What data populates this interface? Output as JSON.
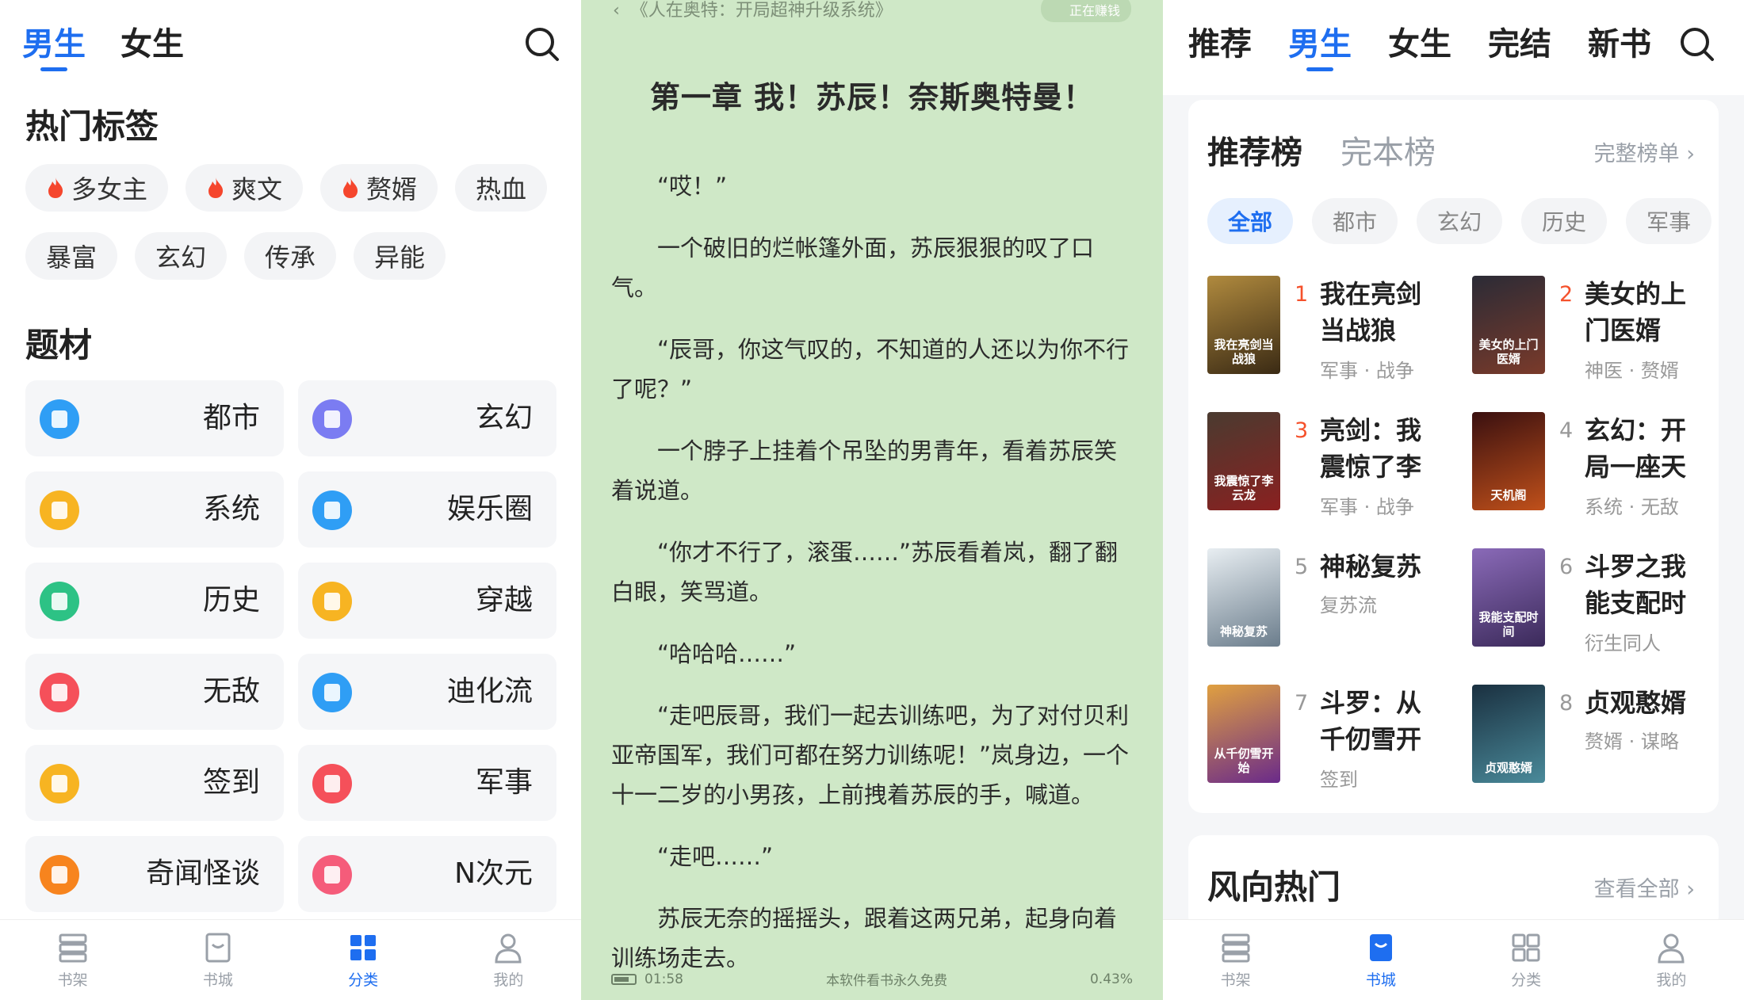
{
  "left": {
    "tabs": [
      {
        "label": "男生",
        "active": true
      },
      {
        "label": "女生",
        "active": false
      }
    ],
    "hot_tags_title": "热门标签",
    "hot_tags_row1": [
      {
        "label": "多女主",
        "hot": true
      },
      {
        "label": "爽文",
        "hot": true
      },
      {
        "label": "赘婿",
        "hot": true
      },
      {
        "label": "热血",
        "hot": false
      }
    ],
    "hot_tags_row2": [
      {
        "label": "暴富"
      },
      {
        "label": "玄幻"
      },
      {
        "label": "传承"
      },
      {
        "label": "异能"
      }
    ],
    "genre_title": "题材",
    "genres": [
      {
        "label": "都市",
        "color": "#2f9ef5",
        "icon": "book-icon"
      },
      {
        "label": "玄幻",
        "color": "#7b7cf2",
        "icon": "swords-icon"
      },
      {
        "label": "系统",
        "color": "#f7b422",
        "icon": "document-icon"
      },
      {
        "label": "娱乐圈",
        "color": "#2f9ef5",
        "icon": "microphone-icon"
      },
      {
        "label": "历史",
        "color": "#2dc285",
        "icon": "building-icon"
      },
      {
        "label": "穿越",
        "color": "#f7b422",
        "icon": "portal-icon"
      },
      {
        "label": "无敌",
        "color": "#f5505a",
        "icon": "fist-icon"
      },
      {
        "label": "迪化流",
        "color": "#2f9ef5",
        "icon": "brain-icon"
      },
      {
        "label": "签到",
        "color": "#f7b422",
        "icon": "location-pin-icon"
      },
      {
        "label": "军事",
        "color": "#f5505a",
        "icon": "rocket-icon"
      },
      {
        "label": "奇闻怪谈",
        "color": "#f7841e",
        "icon": "bulb-icon"
      },
      {
        "label": "N次元",
        "color": "#f55c7a",
        "icon": "fish-icon"
      }
    ],
    "nav": [
      {
        "label": "书架",
        "active": false
      },
      {
        "label": "书城",
        "active": false
      },
      {
        "label": "分类",
        "active": true
      },
      {
        "label": "我的",
        "active": false
      }
    ]
  },
  "reader": {
    "book_title": "《人在奥特：开局超神升级系统》",
    "earn_badge": "正在赚钱",
    "chapter_title": "第一章 我！苏辰！奈斯奥特曼！",
    "paragraphs": [
      "“哎！”",
      "一个破旧的烂帐篷外面，苏辰狠狠的叹了口气。",
      "“辰哥，你这气叹的，不知道的人还以为你不行了呢？”",
      "一个脖子上挂着个吊坠的男青年，看着苏辰笑着说道。",
      "“你才不行了，滚蛋……”苏辰看着岚，翻了翻白眼，笑骂道。",
      "“哈哈哈……”",
      "“走吧辰哥，我们一起去训练吧，为了对付贝利亚帝国军，我们可都在努力训练呢！”岚身边，一个十一二岁的小男孩，上前拽着苏辰的手，喊道。",
      "“走吧……”",
      "苏辰无奈的摇摇头，跟着这两兄弟，起身向着训练场走去。"
    ],
    "time": "01:58",
    "footer_note": "本软件看书永久免费",
    "progress": "0.43%"
  },
  "right": {
    "tabs": [
      {
        "label": "推荐",
        "active": false
      },
      {
        "label": "男生",
        "active": true
      },
      {
        "label": "女生",
        "active": false
      },
      {
        "label": "完结",
        "active": false
      },
      {
        "label": "新书",
        "active": false
      }
    ],
    "rank_tabs": [
      {
        "label": "推荐榜",
        "active": true
      },
      {
        "label": "完本榜",
        "active": false
      }
    ],
    "full_list_link": "完整榜单 ›",
    "chips": [
      {
        "label": "全部",
        "active": true
      },
      {
        "label": "都市",
        "active": false
      },
      {
        "label": "玄幻",
        "active": false
      },
      {
        "label": "历史",
        "active": false
      },
      {
        "label": "军事",
        "active": false
      }
    ],
    "books": [
      {
        "rank": "1",
        "title": "我在亮剑当战狼",
        "tags": "军事 · 战争",
        "cover_text": "我在亮剑当战狼",
        "cover_colors": [
          "#b08a3e",
          "#3a2a14"
        ]
      },
      {
        "rank": "2",
        "title": "美女的上门医婿",
        "tags": "神医 · 赘婿",
        "cover_text": "美女的上门医婿",
        "cover_colors": [
          "#2b2b36",
          "#7a3a2a"
        ]
      },
      {
        "rank": "3",
        "title": "亮剑：我震惊了李",
        "tags": "军事 · 战争",
        "cover_text": "我震惊了李云龙",
        "cover_colors": [
          "#4a3b30",
          "#8a2020"
        ]
      },
      {
        "rank": "4",
        "title": "玄幻：开局一座天",
        "tags": "系统 · 无敌",
        "cover_text": "天机阁",
        "cover_colors": [
          "#3a1010",
          "#c0501a"
        ]
      },
      {
        "rank": "5",
        "title": "神秘复苏",
        "tags": "复苏流",
        "cover_text": "神秘复苏",
        "cover_colors": [
          "#e8eef2",
          "#6b7d8c"
        ]
      },
      {
        "rank": "6",
        "title": "斗罗之我能支配时",
        "tags": "衍生同人",
        "cover_text": "我能支配时间",
        "cover_colors": [
          "#8a6ab8",
          "#3b2a5a"
        ]
      },
      {
        "rank": "7",
        "title": "斗罗：从千仞雪开",
        "tags": "签到",
        "cover_text": "从千仞雪开始",
        "cover_colors": [
          "#e0a040",
          "#6a2a8a"
        ]
      },
      {
        "rank": "8",
        "title": "贞观憨婿",
        "tags": "赘婿 · 谋略",
        "cover_text": "贞观憨婿",
        "cover_colors": [
          "#1a3040",
          "#4a8a9a"
        ]
      }
    ],
    "trend_title": "风向热门",
    "view_all_link": "查看全部 ›",
    "nav": [
      {
        "label": "书架",
        "active": false
      },
      {
        "label": "书城",
        "active": true
      },
      {
        "label": "分类",
        "active": false
      },
      {
        "label": "我的",
        "active": false
      }
    ]
  },
  "colors": {
    "accent": "#1e6ef0",
    "rank_hot": "#f5512b",
    "reader_bg": "#cfe8c7"
  }
}
